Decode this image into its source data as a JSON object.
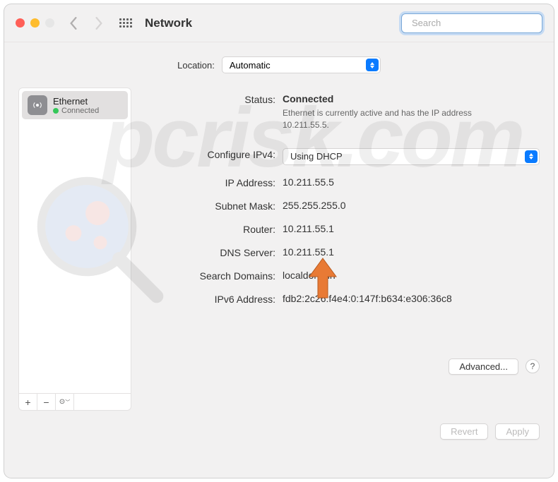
{
  "window_title": "Network",
  "search": {
    "placeholder": "Search",
    "value": ""
  },
  "location": {
    "label": "Location:",
    "value": "Automatic"
  },
  "sidebar": {
    "items": [
      {
        "name": "Ethernet",
        "status": "Connected"
      }
    ]
  },
  "main": {
    "status_label": "Status:",
    "status_value": "Connected",
    "status_desc": "Ethernet is currently active and has the IP address 10.211.55.5.",
    "configure_label": "Configure IPv4:",
    "configure_value": "Using DHCP",
    "ip_label": "IP Address:",
    "ip_value": "10.211.55.5",
    "subnet_label": "Subnet Mask:",
    "subnet_value": "255.255.255.0",
    "router_label": "Router:",
    "router_value": "10.211.55.1",
    "dns_label": "DNS Server:",
    "dns_value": "10.211.55.1",
    "domains_label": "Search Domains:",
    "domains_value": "localdomain",
    "ipv6_label": "IPv6 Address:",
    "ipv6_value": "fdb2:2c26:f4e4:0:147f:b634:e306:36c8",
    "advanced_label": "Advanced...",
    "revert_label": "Revert",
    "apply_label": "Apply"
  },
  "sidebar_buttons": {
    "add": "+",
    "remove": "−",
    "action": "⊙﹀"
  },
  "watermark": "pcrisk.com"
}
